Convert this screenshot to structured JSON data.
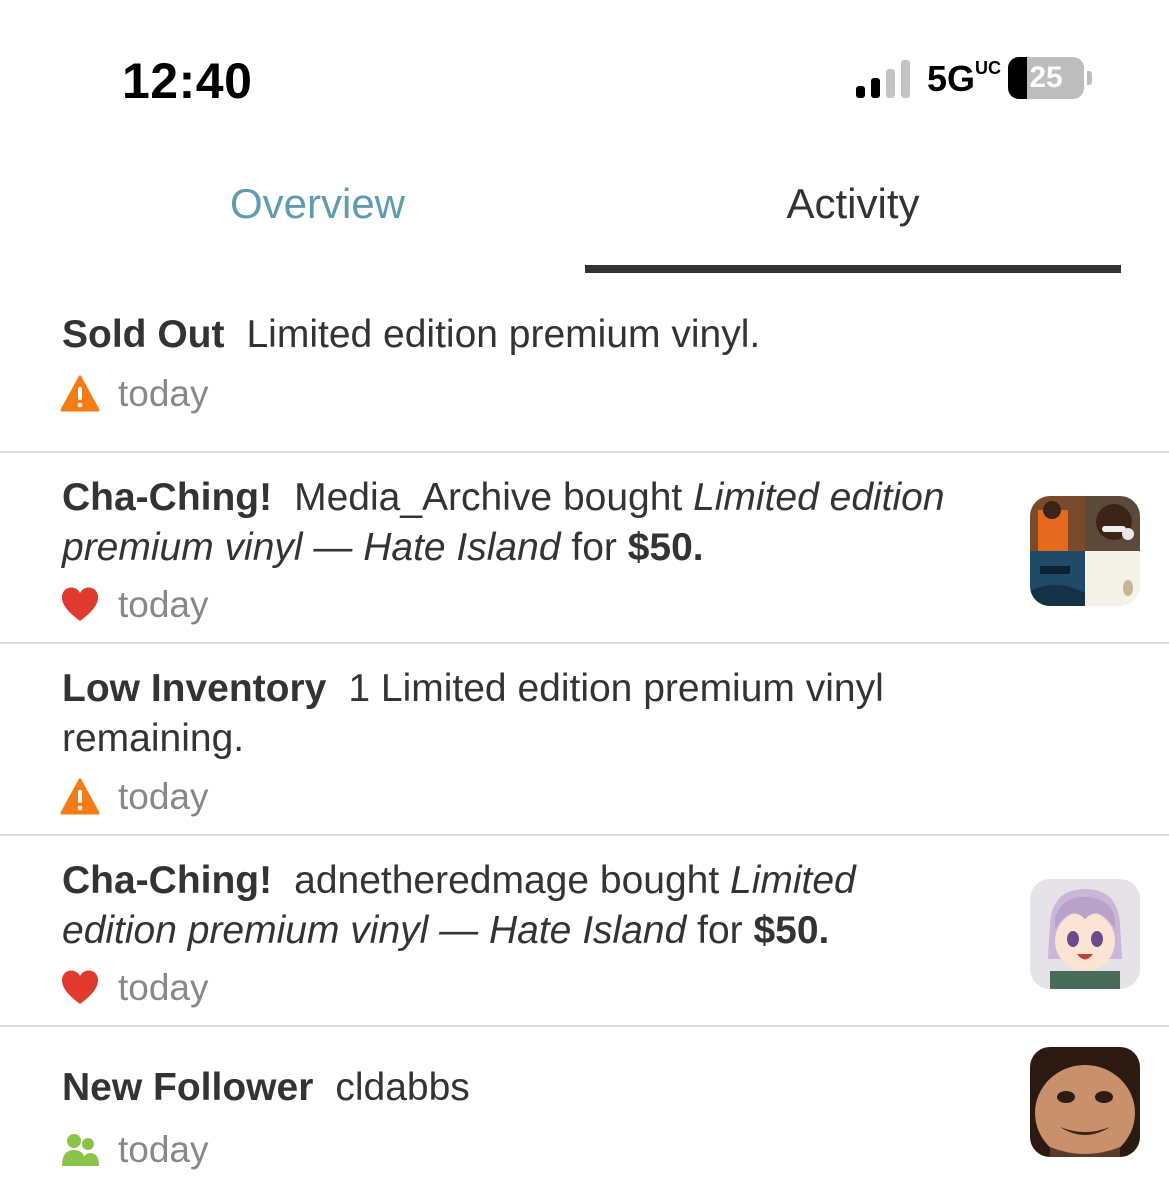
{
  "status_bar": {
    "time": "12:40",
    "network": "5G",
    "network_suffix": "UC",
    "battery": "25",
    "battery_level_percent": 25
  },
  "tabs": [
    {
      "label": "Overview",
      "selected": false
    },
    {
      "label": "Activity",
      "selected": true
    }
  ],
  "feed": [
    {
      "kind": "Sold Out",
      "text": "Limited edition premium vinyl.",
      "time": "today",
      "icon": "warning-icon"
    },
    {
      "kind": "Cha-Ching!",
      "buyer": "Media_Archive",
      "verb": "bought",
      "item": "Limited edition premium vinyl — Hate Island",
      "for_text": "for",
      "price": "$50.",
      "time": "today",
      "icon": "heart-icon",
      "avatar": "media-archive-avatar"
    },
    {
      "kind": "Low Inventory",
      "text": "1 Limited edition premium vinyl remaining.",
      "time": "today",
      "icon": "warning-icon"
    },
    {
      "kind": "Cha-Ching!",
      "buyer": "adnetheredmage",
      "verb": "bought",
      "item": "Limited edition premium vinyl — Hate Island",
      "for_text": "for",
      "price": "$50.",
      "time": "today",
      "icon": "heart-icon",
      "avatar": "adnetheredmage-avatar"
    },
    {
      "kind": "New Follower",
      "text": "cldabbs",
      "time": "today",
      "icon": "followers-icon",
      "avatar": "cldabbs-avatar"
    }
  ],
  "colors": {
    "tab_inactive": "#5f9cae",
    "text": "#333333",
    "muted": "#888888",
    "warning": "#f47b16",
    "heart": "#e03a2f",
    "follower": "#8bc34a",
    "divider": "#dedede"
  }
}
